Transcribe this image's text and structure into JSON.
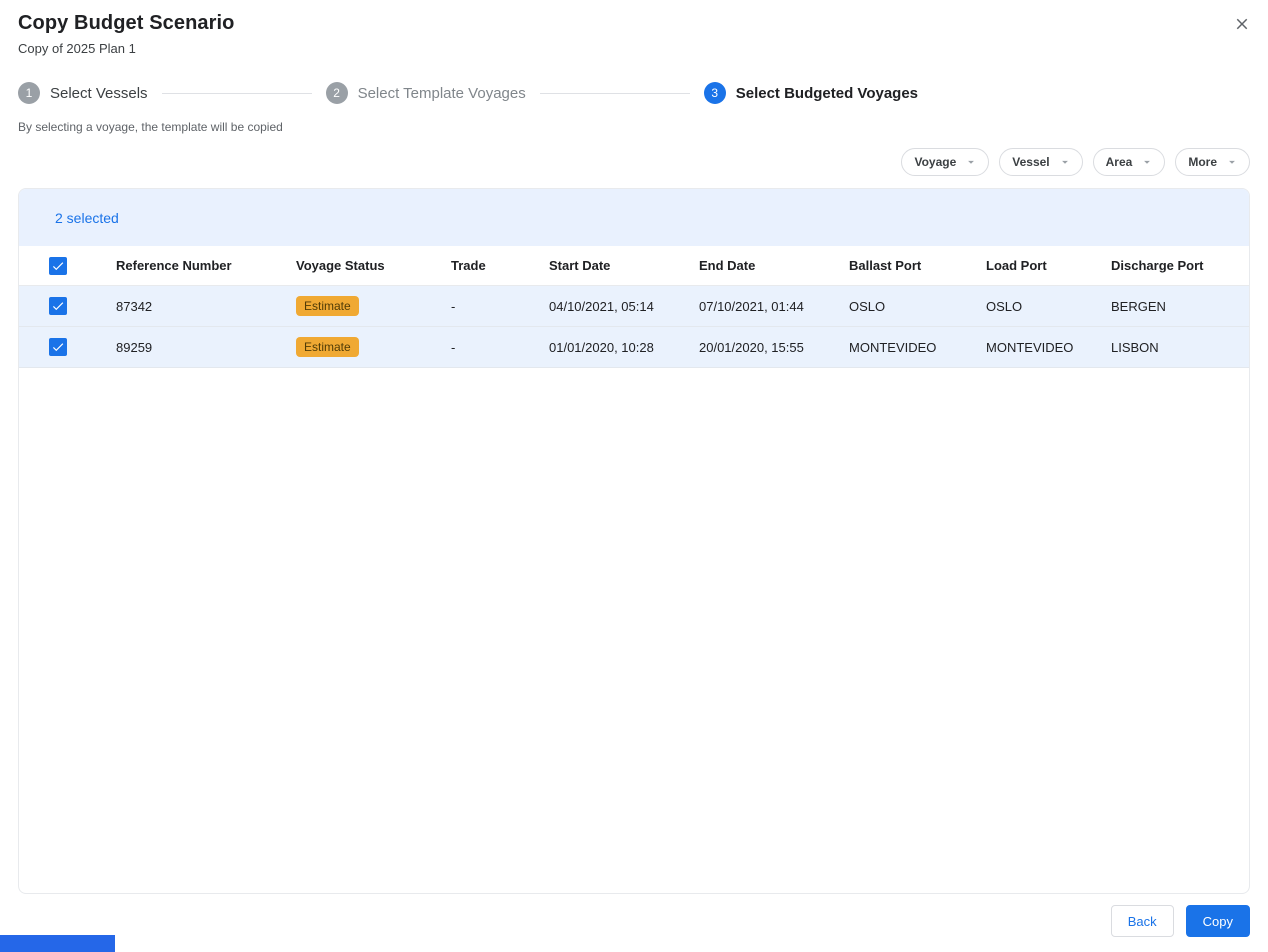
{
  "dialog": {
    "title": "Copy Budget Scenario",
    "subtitle": "Copy of 2025 Plan 1"
  },
  "stepper": {
    "steps": [
      {
        "number": "1",
        "label": "Select Vessels",
        "state": "done"
      },
      {
        "number": "2",
        "label": "Select Template Voyages",
        "state": "inactive"
      },
      {
        "number": "3",
        "label": "Select Budgeted Voyages",
        "state": "active"
      }
    ],
    "helper": "By selecting a voyage, the template will be copied"
  },
  "filters": {
    "voyage": "Voyage",
    "vessel": "Vessel",
    "area": "Area",
    "more": "More"
  },
  "table": {
    "selection_summary": "2 selected",
    "columns": [
      "Reference Number",
      "Voyage Status",
      "Trade",
      "Start Date",
      "End Date",
      "Ballast Port",
      "Load Port",
      "Discharge Port"
    ],
    "rows": [
      {
        "selected": true,
        "reference": "87342",
        "status": "Estimate",
        "trade": "-",
        "start": "04/10/2021, 05:14",
        "end": "07/10/2021, 01:44",
        "ballast": "OSLO",
        "load": "OSLO",
        "discharge": "BERGEN"
      },
      {
        "selected": true,
        "reference": "89259",
        "status": "Estimate",
        "trade": "-",
        "start": "01/01/2020, 10:28",
        "end": "20/01/2020, 15:55",
        "ballast": "MONTEVIDEO",
        "load": "MONTEVIDEO",
        "discharge": "LISBON"
      }
    ]
  },
  "footer": {
    "back_label": "Back",
    "copy_label": "Copy"
  },
  "colors": {
    "accent": "#1a73e8",
    "selected_row_bg": "#eaf2fd",
    "selection_bar_bg": "#e9f1fe",
    "badge_bg": "#f0a933",
    "badge_text": "#513c06",
    "inactive_step": "#9aa0a6"
  }
}
